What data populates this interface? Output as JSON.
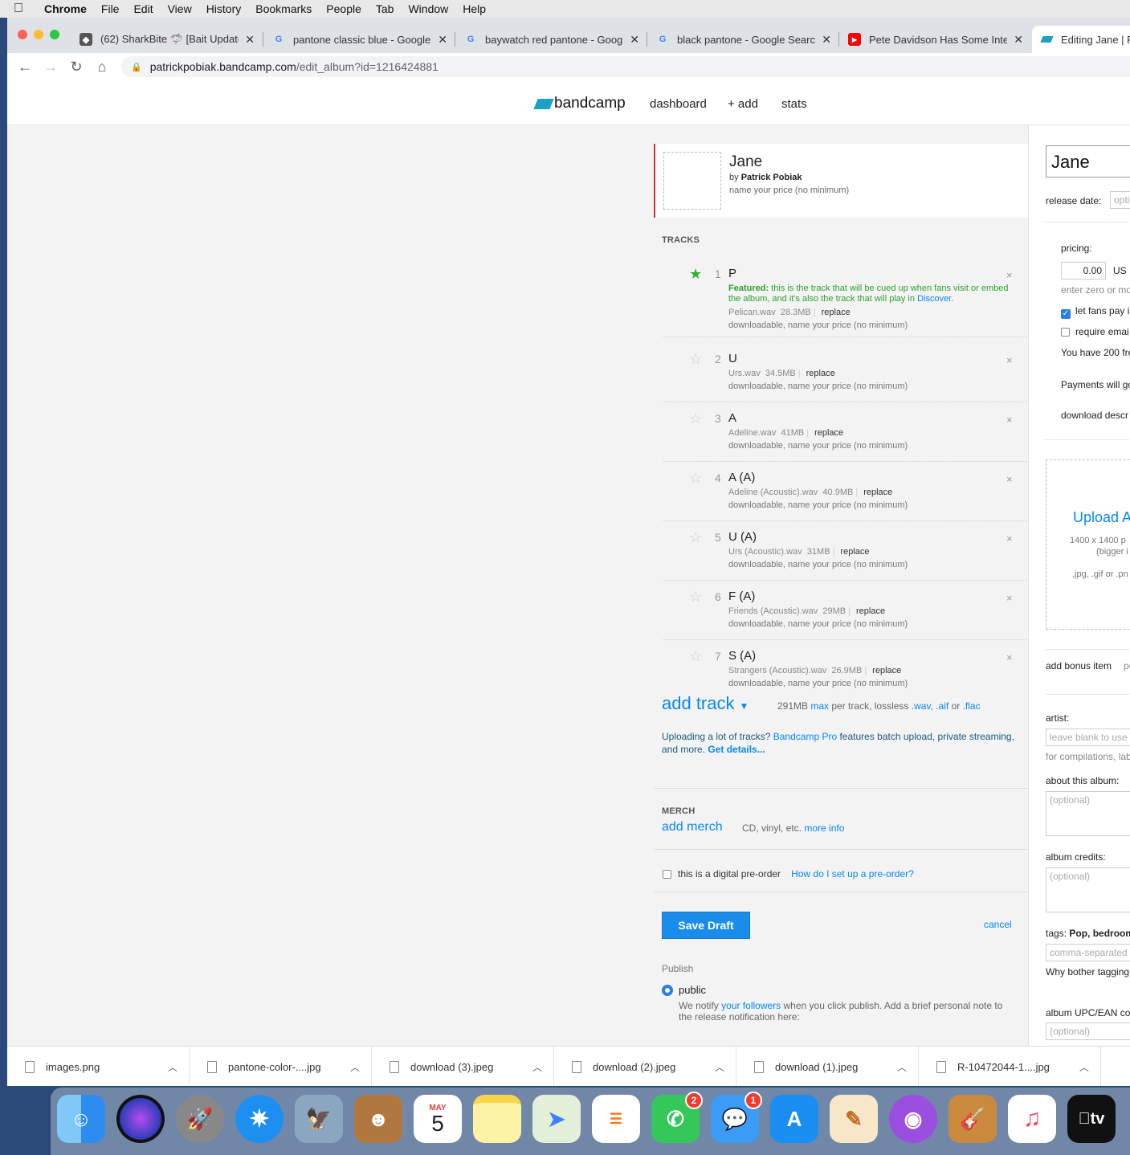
{
  "menubar": {
    "app": "Chrome",
    "items": [
      "File",
      "Edit",
      "View",
      "History",
      "Bookmarks",
      "People",
      "Tab",
      "Window",
      "Help"
    ]
  },
  "tabs": [
    {
      "title": "(62) SharkBite 🦈 [Bait Update",
      "icon": "roblox-icon"
    },
    {
      "title": "pantone classic blue - Google S",
      "icon": "google-icon"
    },
    {
      "title": "baywatch red pantone - Google",
      "icon": "google-icon"
    },
    {
      "title": "black pantone - Google Search",
      "icon": "google-icon"
    },
    {
      "title": "Pete Davidson Has Some Intere",
      "icon": "youtube-icon"
    },
    {
      "title": "Editing Jane | Pa",
      "icon": "bandcamp-icon",
      "active": true
    }
  ],
  "address": {
    "host": "patrickpobiak.bandcamp.com",
    "path": "/edit_album?id=1216424881"
  },
  "bandcamp": {
    "logo": "bandcamp",
    "nav": [
      "dashboard",
      "+ add",
      "stats"
    ]
  },
  "album": {
    "title": "Jane",
    "by": "by",
    "artist": "Patrick Pobiak",
    "price": "name your price (no minimum)"
  },
  "tracks_header": "TRACKS",
  "featured": {
    "label": "Featured:",
    "text": " this is the track that will be cued up when fans visit or embed the album, and it's also the track that will play in ",
    "link": "Discover",
    "end": "."
  },
  "tracks": [
    {
      "num": "1",
      "name": "P",
      "file": "Pelican.wav",
      "size": "28.3MB",
      "featured": true
    },
    {
      "num": "2",
      "name": "U",
      "file": "Urs.wav",
      "size": "34.5MB"
    },
    {
      "num": "3",
      "name": "A",
      "file": "Adeline.wav",
      "size": "41MB"
    },
    {
      "num": "4",
      "name": "A (A)",
      "file": "Adeline (Acoustic).wav",
      "size": "40.9MB"
    },
    {
      "num": "5",
      "name": "U (A)",
      "file": "Urs (Acoustic).wav",
      "size": "31MB"
    },
    {
      "num": "6",
      "name": "F (A)",
      "file": "Friends (Acoustic).wav",
      "size": "29MB"
    },
    {
      "num": "7",
      "name": "S (A)",
      "file": "Strangers (Acoustic).wav",
      "size": "26.9MB"
    }
  ],
  "track_labels": {
    "replace": "replace",
    "downloadable": "downloadable, name your price (no minimum)",
    "remove": "×"
  },
  "add_track": {
    "label": "add track",
    "size": "291MB",
    "max": "max",
    "per": " per track, lossless ",
    "wav": ".wav",
    "comma": ", ",
    "aif": ".aif",
    "or": " or ",
    "flac": ".flac"
  },
  "protip": {
    "a": "Uploading a lot of tracks? ",
    "pro": "Bandcamp Pro",
    "b": " features batch upload, private streaming, and more. ",
    "details": "Get details..."
  },
  "merch": {
    "header": "MERCH",
    "add": "add merch",
    "info": "CD, vinyl, etc. ",
    "more": "more info"
  },
  "preorder": {
    "label": "this is a digital pre-order",
    "help": "How do I set up a pre-order?"
  },
  "actions": {
    "save": "Save Draft",
    "cancel": "cancel"
  },
  "publish": {
    "header": "Publish",
    "option": "public",
    "note_a": "We notify ",
    "note_link": "your followers",
    "note_b": " when you click publish. Add a brief personal note to the release notification here:"
  },
  "right": {
    "title_value": "Jane",
    "release_date": "release date:",
    "release_placeholder": "opti",
    "pricing": "pricing:",
    "price_value": "0.00",
    "currency": "US",
    "enter_zero": "enter zero or mo",
    "let_fans": "let fans pay i",
    "require_email": "require emai",
    "you_have": "You have 200 fre",
    "payments": "Payments will go",
    "download_desc": "download descr",
    "upload_title": "Upload A",
    "upload_dims": "1400 x 1400 p",
    "upload_bigger": "(bigger i",
    "upload_types": ".jpg, .gif or .pn",
    "add_bonus": "add bonus item",
    "bonus_trail": "pe",
    "artist": "artist:",
    "artist_placeholder": "leave blank to use a",
    "compilations": "for compilations, lab",
    "about": "about this album:",
    "optional": "(optional)",
    "credits": "album credits:",
    "tags_label": "tags: ",
    "tags_value": "Pop, bedroom",
    "tags_placeholder": "comma-separated",
    "why_tag": "Why bother tagging",
    "upc": "album UPC/EAN co"
  },
  "downloads": [
    {
      "name": "images.png"
    },
    {
      "name": "pantone-color-....jpg"
    },
    {
      "name": "download (3).jpeg"
    },
    {
      "name": "download (2).jpeg"
    },
    {
      "name": "download (1).jpeg"
    },
    {
      "name": "R-10472044-1....jpg"
    }
  ],
  "dock": {
    "calendar_month": "MAY",
    "calendar_day": "5",
    "facetime_badge": "2",
    "messages_badge": "1",
    "tv_label": "tv"
  },
  "colors": {
    "bandcamp_blue": "#1da0c3",
    "link_blue": "#0687f5",
    "featured_green": "#2db52d",
    "save_button": "#1a8cec",
    "album_accent": "#c4333b"
  }
}
